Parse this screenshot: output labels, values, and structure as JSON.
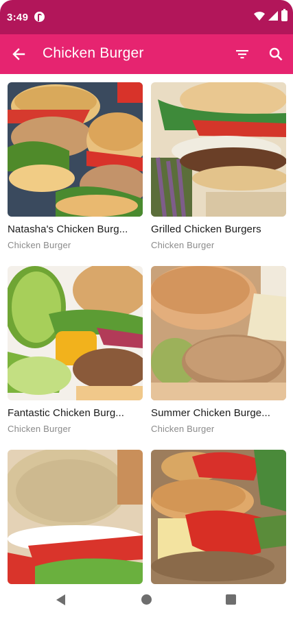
{
  "status_bar": {
    "time": "3:49"
  },
  "app_bar": {
    "title": "Chicken Burger"
  },
  "recipes": [
    {
      "title": "Natasha's Chicken Burg...",
      "category": "Chicken Burger"
    },
    {
      "title": "Grilled Chicken Burgers",
      "category": "Chicken Burger"
    },
    {
      "title": "Fantastic Chicken Burg...",
      "category": "Chicken Burger"
    },
    {
      "title": "Summer Chicken Burge...",
      "category": "Chicken Burger"
    },
    {
      "title": "",
      "category": ""
    },
    {
      "title": "",
      "category": ""
    }
  ],
  "colors": {
    "status_bar": "#b2165a",
    "app_bar": "#e62470",
    "text_primary": "#1a1a1a",
    "text_secondary": "#8a8a8a"
  },
  "icons": [
    "back-arrow",
    "filter",
    "search",
    "wifi",
    "signal",
    "battery",
    "nav-back",
    "nav-home",
    "nav-recents"
  ]
}
